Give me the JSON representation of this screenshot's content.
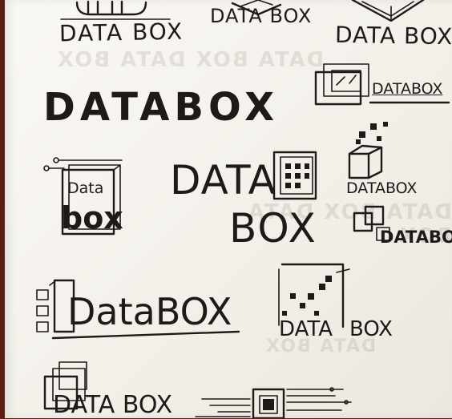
{
  "image": {
    "subject": "photo",
    "paper_color": "#f6f3ee",
    "ink_color": "#1f1a17",
    "background_color": "#5a1f12"
  },
  "sketches": {
    "s1": "DATA BOX",
    "s2": "DATA BOX",
    "s3": "DATA BOX",
    "s4": "DATABOX",
    "s5": "DATABOX",
    "s6_line1": "DATA",
    "s6_line2": "BOX",
    "s7": "DATABOX",
    "s8_line1": "Data",
    "s8_line2": "box",
    "s9": "DATABOX",
    "s10": "DataBOX",
    "s11_left": "DATA",
    "s11_right": "BOX",
    "s12": "DATA BOX"
  }
}
